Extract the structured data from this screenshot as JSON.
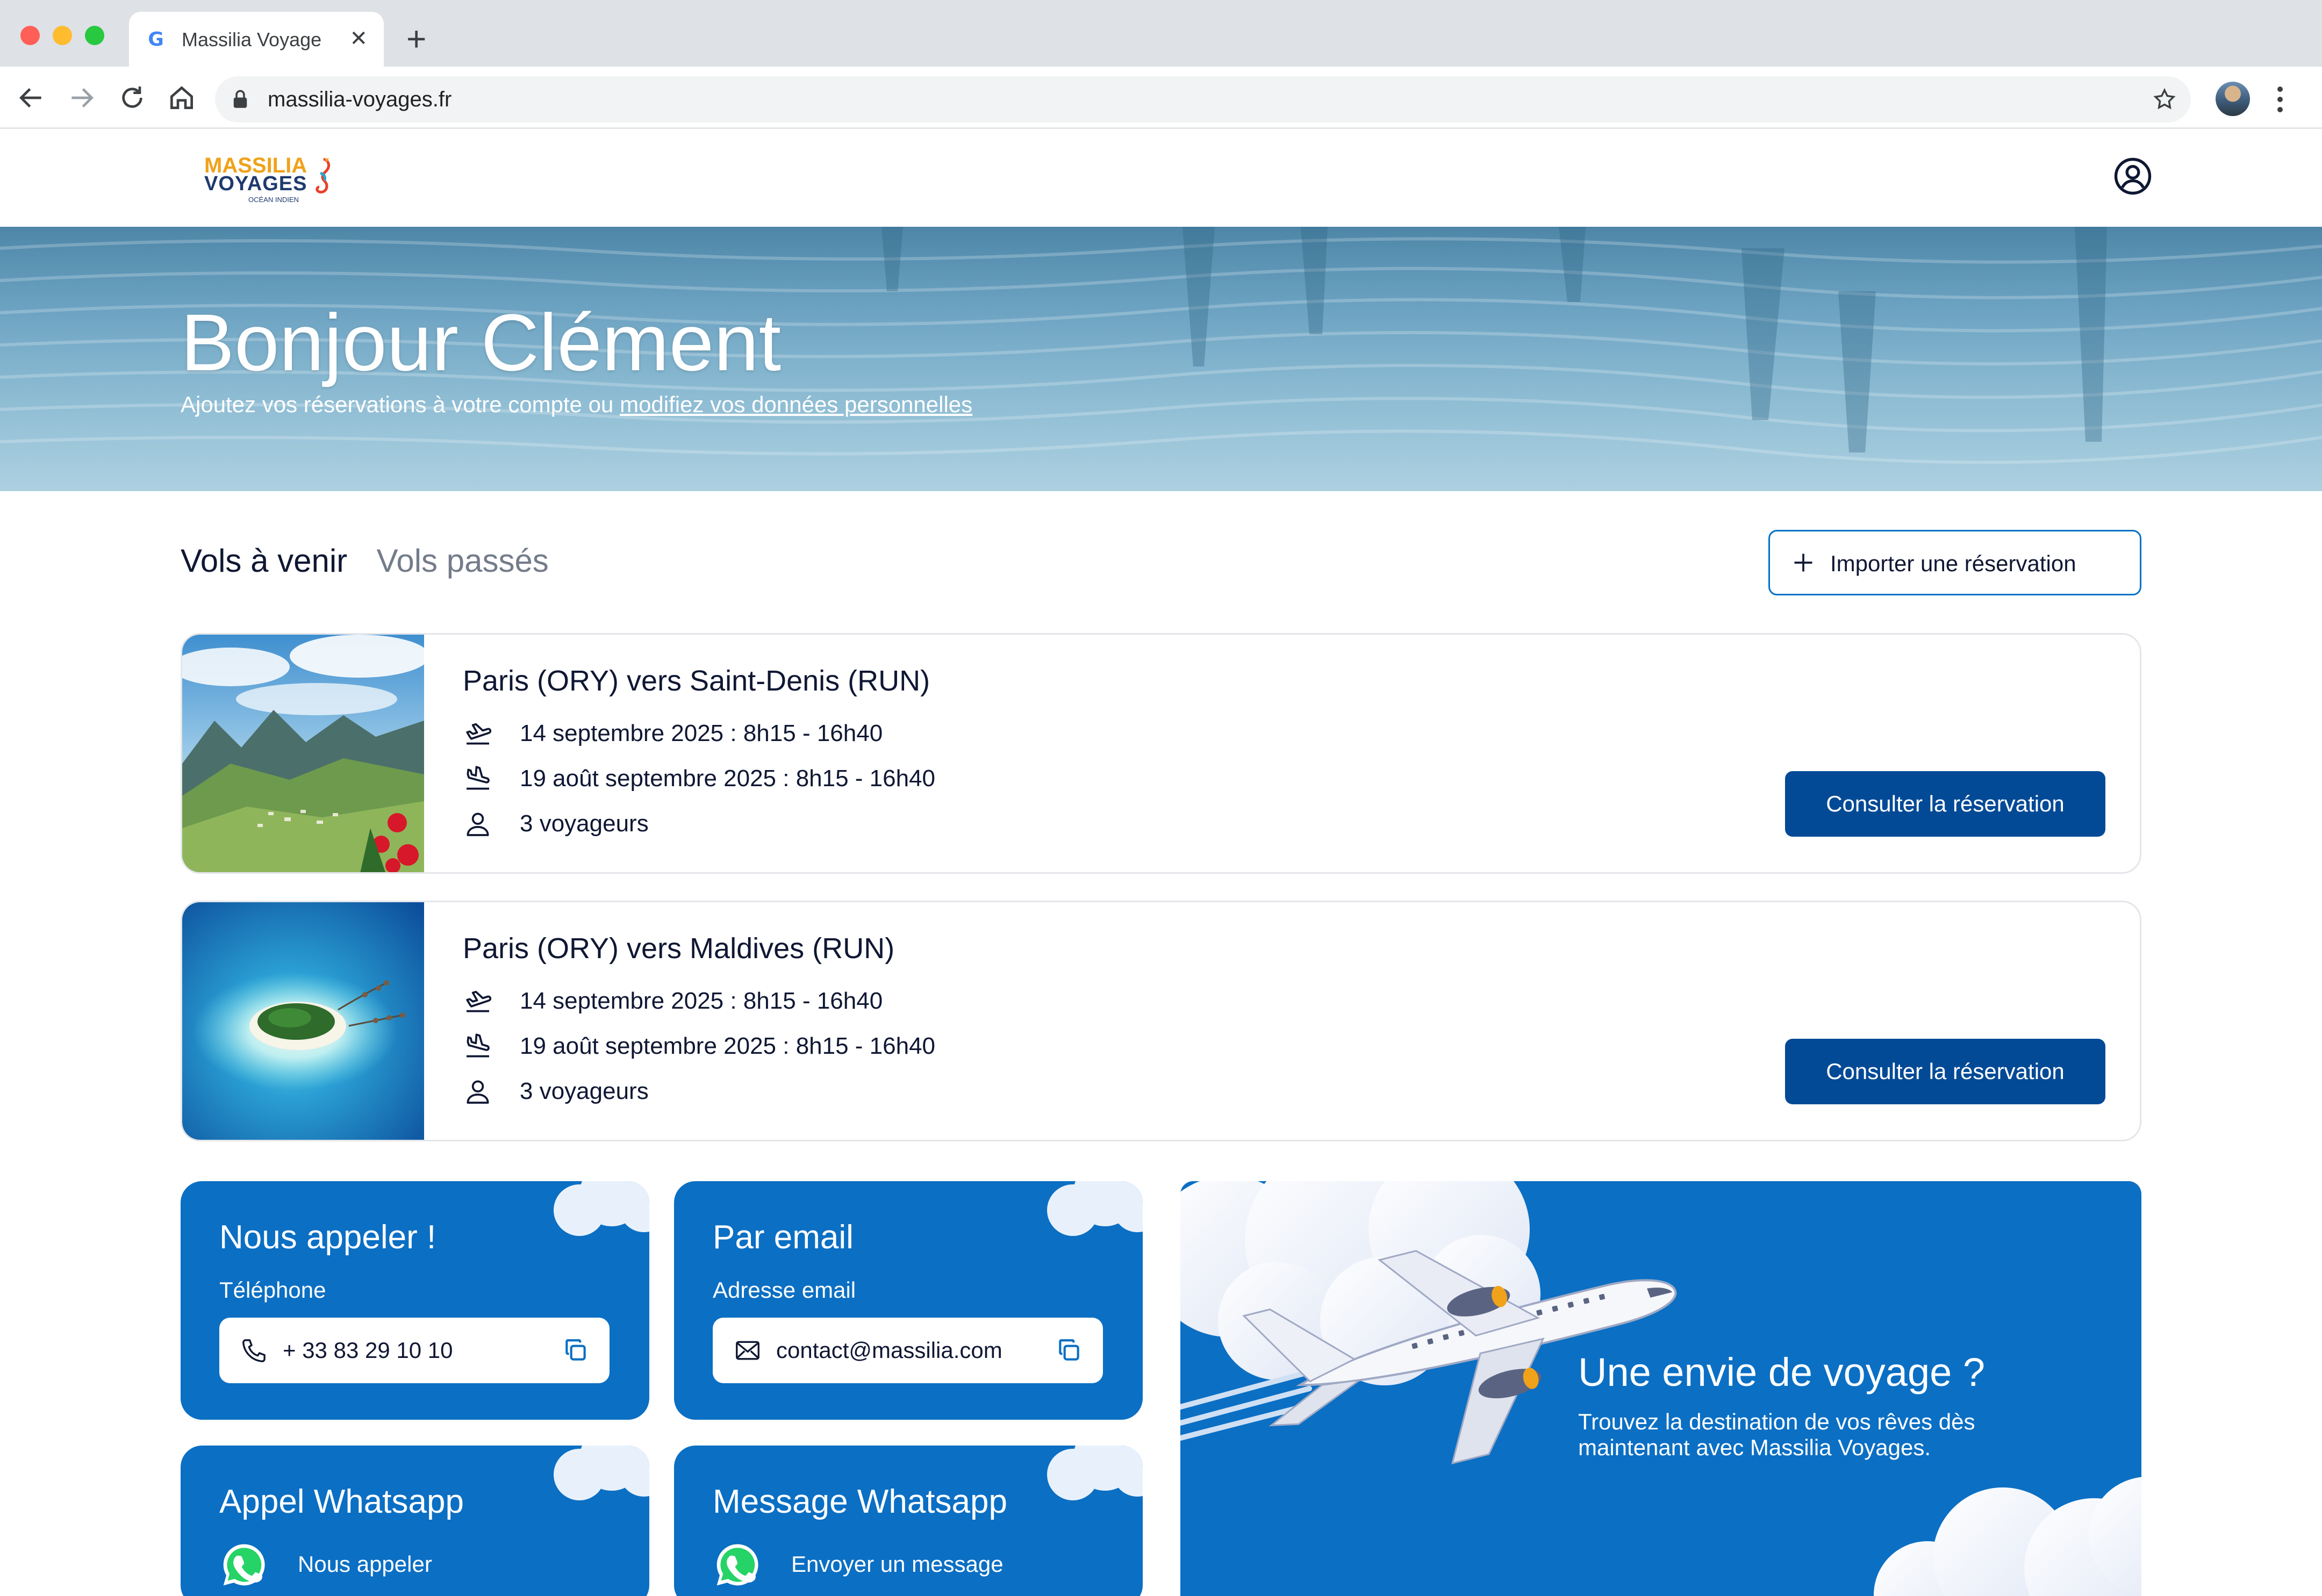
{
  "browser": {
    "tab_title": "Massilia Voyage",
    "tab_favicon": "G",
    "url": "massilia-voyages.fr"
  },
  "site": {
    "logo_line1": "MASSILIA",
    "logo_line2": "VOYAGES",
    "logo_line3": "OCÉAN INDIEN"
  },
  "hero": {
    "title": "Bonjour Clément",
    "subtitle_prefix": "Ajoutez vos réservations à votre compte ou ",
    "subtitle_link": "modifiez vos données personnelles"
  },
  "tabs": {
    "upcoming": "Vols à venir",
    "past": "Vols passés"
  },
  "import_button": "Importer une réservation",
  "bookings": [
    {
      "title": "Paris (ORY) vers Saint-Denis (RUN)",
      "departure": "14 septembre 2025 : 8h15 - 16h40",
      "return": "19 août septembre 2025 : 8h15 - 16h40",
      "travellers": "3 voyageurs",
      "cta": "Consulter la réservation"
    },
    {
      "title": "Paris (ORY) vers Maldives (RUN)",
      "departure": "14 septembre 2025 : 8h15 - 16h40",
      "return": "19 août septembre 2025 : 8h15 - 16h40",
      "travellers": "3 voyageurs",
      "cta": "Consulter la réservation"
    }
  ],
  "contact": {
    "phone": {
      "title": "Nous appeler !",
      "label": "Téléphone",
      "value": "+ 33 83 29 10 10"
    },
    "email": {
      "title": "Par email",
      "label": "Adresse email",
      "value": "contact@massilia.com"
    },
    "wa_call": {
      "title": "Appel Whatsapp",
      "label": "Nous appeler"
    },
    "wa_message": {
      "title": "Message Whatsapp",
      "label": "Envoyer un message"
    }
  },
  "promo": {
    "title": "Une envie de voyage ?",
    "text": "Trouvez la destination de vos rêves dès maintenant avec Massilia Voyages."
  },
  "colors": {
    "brand_blue": "#0b6fc4",
    "cta_blue": "#034a96",
    "accent_orange": "#f0a21a",
    "text_dark": "#0f1733",
    "whatsapp_green": "#25d366"
  },
  "icons": [
    "back-icon",
    "forward-icon",
    "reload-icon",
    "home-icon",
    "lock-icon",
    "star-icon",
    "user-icon",
    "plus-icon",
    "plane-departure-icon",
    "plane-arrival-icon",
    "person-icon",
    "phone-icon",
    "mail-icon",
    "copy-icon",
    "whatsapp-icon"
  ]
}
